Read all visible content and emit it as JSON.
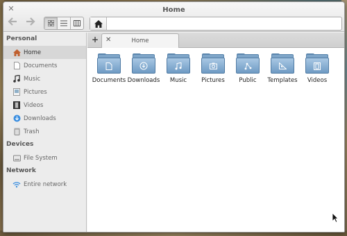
{
  "window": {
    "title": "Home"
  },
  "sidebar": {
    "sections": [
      {
        "title": "Personal",
        "items": [
          {
            "label": "Home",
            "icon": "home-icon",
            "active": true
          },
          {
            "label": "Documents",
            "icon": "document-icon"
          },
          {
            "label": "Music",
            "icon": "music-note-icon"
          },
          {
            "label": "Pictures",
            "icon": "picture-icon"
          },
          {
            "label": "Videos",
            "icon": "film-icon"
          },
          {
            "label": "Downloads",
            "icon": "download-icon"
          },
          {
            "label": "Trash",
            "icon": "trash-icon"
          }
        ]
      },
      {
        "title": "Devices",
        "items": [
          {
            "label": "File System",
            "icon": "drive-icon"
          }
        ]
      },
      {
        "title": "Network",
        "items": [
          {
            "label": "Entire network",
            "icon": "network-icon"
          }
        ]
      }
    ]
  },
  "tabs": [
    {
      "label": "Home"
    }
  ],
  "folders": [
    {
      "label": "Documents",
      "emblem": "document-emblem-icon"
    },
    {
      "label": "Downloads",
      "emblem": "download-emblem-icon"
    },
    {
      "label": "Music",
      "emblem": "music-emblem-icon"
    },
    {
      "label": "Pictures",
      "emblem": "picture-emblem-icon"
    },
    {
      "label": "Public",
      "emblem": "share-emblem-icon"
    },
    {
      "label": "Templates",
      "emblem": "template-emblem-icon"
    },
    {
      "label": "Videos",
      "emblem": "video-emblem-icon"
    }
  ],
  "colors": {
    "folder": "#7ea5c8",
    "folder_dark": "#4f7aa3",
    "sidebar_bg": "#ececec",
    "selected": "#d7d7d7"
  }
}
